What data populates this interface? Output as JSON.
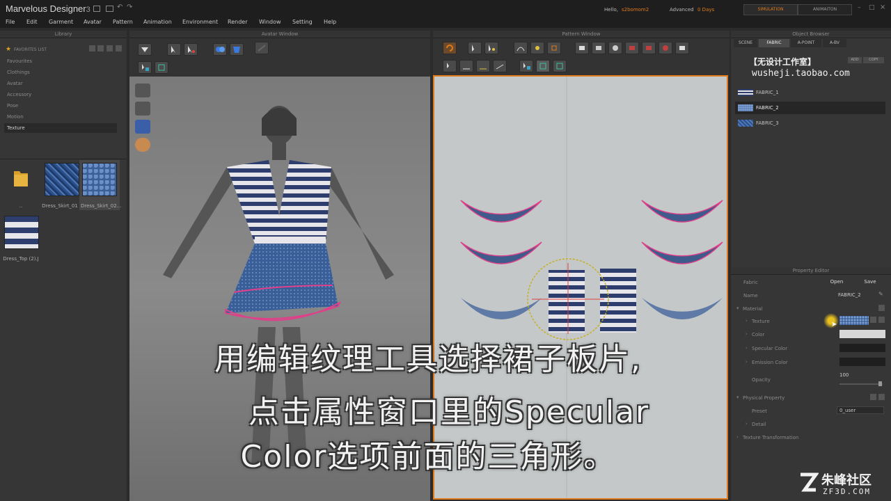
{
  "app": {
    "name": "Marvelous Designer",
    "version": "3"
  },
  "header": {
    "hello_label": "Hello,",
    "user": "s2bomom2",
    "edition": "Advanced",
    "days": "0 Days",
    "mode_simulation": "SIMULATION",
    "mode_animation": "ANIMAITON"
  },
  "menu": [
    "File",
    "Edit",
    "Garment",
    "Avatar",
    "Pattern",
    "Animation",
    "Environment",
    "Render",
    "Window",
    "Setting",
    "Help"
  ],
  "library": {
    "title": "Library",
    "favorites": "FAVORITES LIST",
    "items": [
      "Favourites",
      "Clothings",
      "Avatar",
      "Accessory",
      "Pose",
      "Motion",
      "Texture"
    ],
    "selected": "Texture",
    "thumbs": [
      {
        "label": ".."
      },
      {
        "label": "Dress_Skirt_01"
      },
      {
        "label": "Dress_Skirt_02..."
      },
      {
        "label": "Dress_Top (2).J"
      }
    ]
  },
  "avatar_window": {
    "title": "Avatar Window"
  },
  "pattern_window": {
    "title": "Pattern Window"
  },
  "object_browser": {
    "title": "Object Browser",
    "tabs": [
      "SCENE",
      "FABRIC",
      "A-POINT",
      "A-BV"
    ],
    "active_tab": "FABRIC",
    "add_label": "ADD",
    "copy_label": "COPY",
    "watermark_top": "【无设计工作室】",
    "watermark_url": "wusheji.taobao.com",
    "fabrics": [
      "FABRIC_1",
      "FABRIC_2",
      "FABRIC_3"
    ],
    "selected_fabric": "FABRIC_2"
  },
  "property_editor": {
    "title": "Property Editor",
    "fabric_label": "Fabric",
    "open_label": "Open",
    "save_label": "Save",
    "name_label": "Name",
    "name_value": "FABRIC_2",
    "material_label": "Material",
    "texture_label": "Texture",
    "color_label": "Color",
    "specular_label": "Specular Color",
    "emission_label": "Emission Color",
    "opacity_label": "Opacity",
    "opacity_value": "100",
    "physical_label": "Physical Property",
    "preset_label": "Preset",
    "preset_value": "0_user",
    "detail_label": "Detail",
    "texture_transform_label": "Texture Transformation"
  },
  "subtitle": {
    "line1": "用编辑纹理工具选择裙子板片,",
    "line2": "点击属性窗口里的Specular",
    "line3": "Color选项前面的三角形。"
  },
  "logo": {
    "name": "朱峰社区",
    "site": "ZF3D.COM"
  },
  "colors": {
    "accent_orange": "#e07a1a",
    "stripe_navy": "#2c3d6e",
    "pattern_blue": "#3f5b8c",
    "selection_pink": "#e0408a"
  }
}
